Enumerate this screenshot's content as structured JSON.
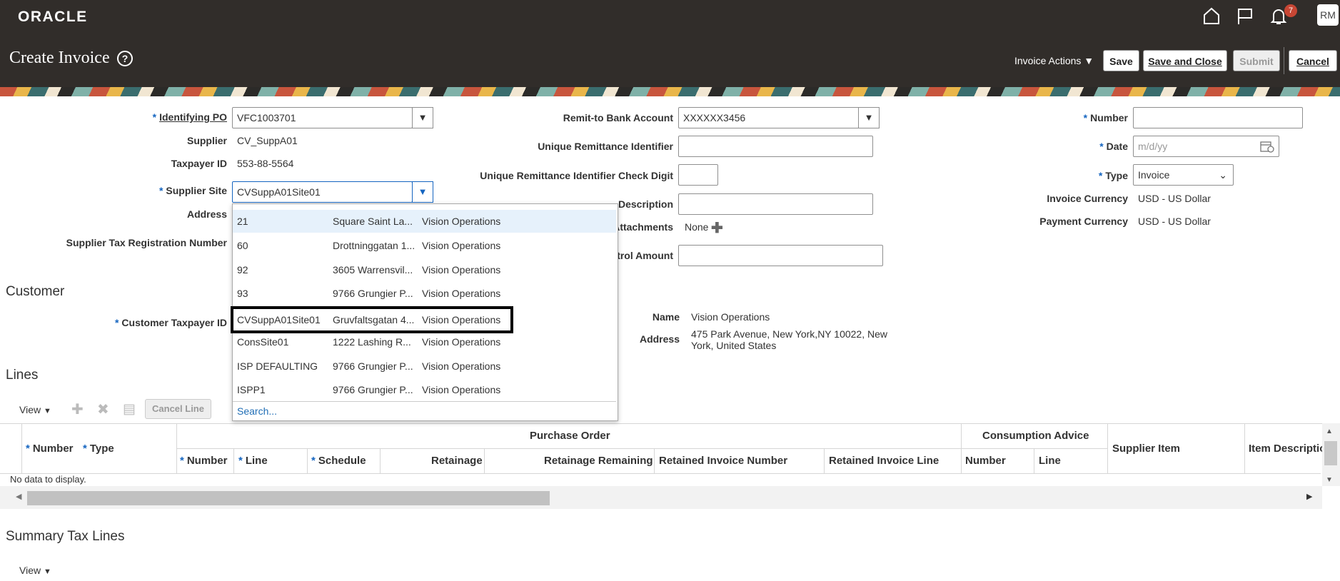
{
  "header": {
    "logo": "ORACLE",
    "page_title": "Create Invoice",
    "help_icon": "?",
    "notification_count": "7",
    "avatar_initials": "RM",
    "invoice_actions": "Invoice Actions",
    "save": "Save",
    "save_and_close": "Save and Close",
    "submit": "Submit",
    "cancel": "Cancel"
  },
  "form": {
    "identifying_po_label": "Identifying PO",
    "identifying_po_value": "VFC1003701",
    "supplier_label": "Supplier",
    "supplier_value": "CV_SuppA01",
    "taxpayer_label": "Taxpayer ID",
    "taxpayer_value": "553-88-5564",
    "supplier_site_label": "Supplier Site",
    "supplier_site_value": "CVSuppA01Site01",
    "address_label": "Address",
    "supplier_tax_reg_label": "Supplier Tax Registration Number",
    "remit_bank_label": "Remit-to Bank Account",
    "remit_bank_value": "XXXXXX3456",
    "unique_remit_label": "Unique Remittance Identifier",
    "unique_remit_check_label": "Unique Remittance Identifier Check Digit",
    "description_label": "Description",
    "attachments_label": "Attachments",
    "attachments_value": "None",
    "control_amount_label": "trol Amount",
    "number_label": "Number",
    "date_label": "Date",
    "date_placeholder": "m/d/yy",
    "type_label": "Type",
    "type_value": "Invoice",
    "invoice_currency_label": "Invoice Currency",
    "invoice_currency_value": "USD - US Dollar",
    "payment_currency_label": "Payment Currency",
    "payment_currency_value": "USD - US Dollar"
  },
  "customer": {
    "section_title": "Customer",
    "customer_taxpayer_label": "Customer Taxpayer ID",
    "name_label": "Name",
    "name_value": "Vision Operations",
    "address_label": "Address",
    "address_line1": "475 Park Avenue, New York,NY 10022, New",
    "address_line2": "York, United States"
  },
  "site_dropdown": {
    "rows": [
      {
        "site": "21",
        "address": "Square Saint La...",
        "bu": "Vision Operations"
      },
      {
        "site": "60",
        "address": "Drottninggatan 1...",
        "bu": "Vision Operations"
      },
      {
        "site": "92",
        "address": "3605 Warrensvil...",
        "bu": "Vision Operations"
      },
      {
        "site": "93",
        "address": "9766 Grungier P...",
        "bu": "Vision Operations"
      },
      {
        "site": "CVSuppA01Site01",
        "address": "Gruvfaltsgatan 4...",
        "bu": "Vision Operations"
      },
      {
        "site": "ConsSite01",
        "address": "1222 Lashing R...",
        "bu": "Vision Operations"
      },
      {
        "site": "ISP DEFAULTING",
        "address": "9766 Grungier P...",
        "bu": "Vision Operations"
      },
      {
        "site": "ISPP1",
        "address": "9766 Grungier P...",
        "bu": "Vision Operations"
      }
    ],
    "search_link": "Search..."
  },
  "lines": {
    "section_title": "Lines",
    "view_menu": "View",
    "cancel_line": "Cancel Line",
    "hdr_number": "Number",
    "hdr_type": "Type",
    "hdr_purchase_order": "Purchase Order",
    "hdr_consumption_advice": "Consumption Advice",
    "hdr_supplier_item": "Supplier Item",
    "hdr_item_description": "Item Descriptio",
    "po_number": "Number",
    "po_line": "Line",
    "po_schedule": "Schedule",
    "retainage": "Retainage",
    "retainage_remaining": "Retainage Remaining",
    "retained_invoice_number": "Retained Invoice Number",
    "retained_invoice_line": "Retained Invoice Line",
    "ca_number": "Number",
    "ca_line": "Line",
    "no_data": "No data to display."
  },
  "summary_tax": {
    "section_title": "Summary Tax Lines",
    "view_menu": "View"
  }
}
